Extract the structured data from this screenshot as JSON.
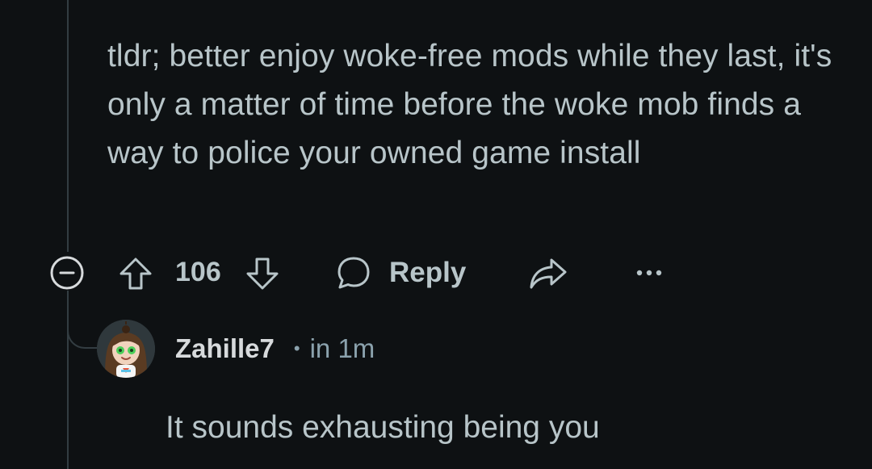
{
  "parent_comment": {
    "body": "tldr; better enjoy woke-free mods while they last, it's only a matter of time before the woke mob finds a way to police your owned game install",
    "score": "106",
    "reply_label": "Reply",
    "collapse_icon": "collapse-minus-icon",
    "upvote_icon": "upvote-arrow-icon",
    "downvote_icon": "downvote-arrow-icon",
    "reply_icon": "speech-bubble-icon",
    "share_icon": "share-arrow-icon",
    "more_icon": "more-dots-icon"
  },
  "reply_comment": {
    "author": "Zahille7",
    "separator": "•",
    "time": "in 1m",
    "body": "It sounds exhausting being you",
    "avatar_icon": "user-avatar"
  },
  "colors": {
    "background": "#0e1113",
    "text": "#b8c5c9",
    "muted": "#8ba2ad",
    "thread_line": "#333d42"
  }
}
